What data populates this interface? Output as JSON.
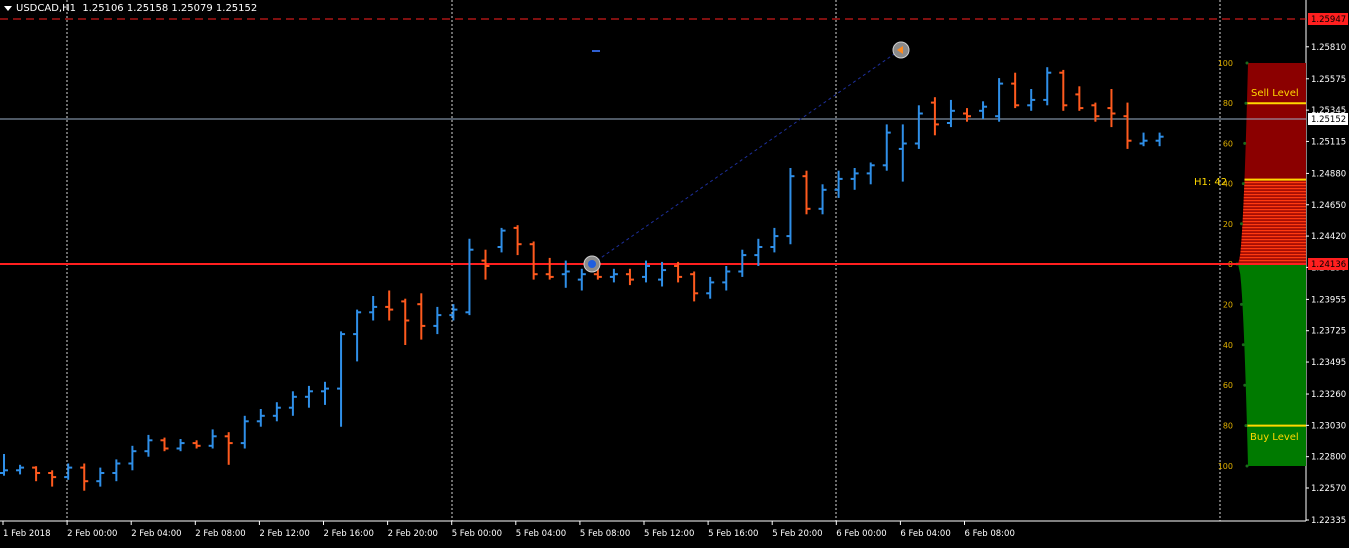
{
  "header": {
    "symbol": "USDCAD,H1",
    "ohlc": "1.25106 1.25158 1.25079 1.25152"
  },
  "colors": {
    "background": "#000000",
    "bull": "#2f8fe8",
    "bear": "#ff5a1e",
    "grid": "#ffffff",
    "axis_text": "#ffffff",
    "red_line": "#ff1f1f",
    "sell_zone": "#8b0000",
    "buy_zone": "#007a00",
    "level_line": "#ffd800",
    "scale_text": "#e0b000"
  },
  "chart_data": {
    "type": "ohlc",
    "price_axis": {
      "labels": [
        "1.25810",
        "1.25575",
        "1.25345",
        "1.25115",
        "1.24880",
        "1.24650",
        "1.24420",
        "1.24190",
        "1.23955",
        "1.23725",
        "1.23495",
        "1.23260",
        "1.23030",
        "1.22800",
        "1.22570",
        "1.22335"
      ],
      "range": [
        1.22335,
        1.2597
      ]
    },
    "time_axis": {
      "labels": [
        "1 Feb 2018",
        "2 Feb 00:00",
        "2 Feb 04:00",
        "2 Feb 08:00",
        "2 Feb 12:00",
        "2 Feb 16:00",
        "2 Feb 20:00",
        "5 Feb 00:00",
        "5 Feb 04:00",
        "5 Feb 08:00",
        "5 Feb 12:00",
        "5 Feb 16:00",
        "5 Feb 20:00",
        "6 Feb 00:00",
        "6 Feb 04:00",
        "6 Feb 08:00"
      ]
    },
    "current_price": "1.25152",
    "top_level_price": "1.25947",
    "red_level_price": "1.24136",
    "bars": [
      [
        1.2268,
        1.2282,
        1.2266,
        1.227
      ],
      [
        1.227,
        1.2274,
        1.2267,
        1.2272
      ],
      [
        1.2272,
        1.2273,
        1.2262,
        1.2268
      ],
      [
        1.2268,
        1.227,
        1.2258,
        1.2265
      ],
      [
        1.2265,
        1.2275,
        1.2263,
        1.2272
      ],
      [
        1.2272,
        1.2275,
        1.2255,
        1.2262
      ],
      [
        1.2262,
        1.2272,
        1.2258,
        1.2268
      ],
      [
        1.2268,
        1.2278,
        1.2262,
        1.2275
      ],
      [
        1.2275,
        1.2288,
        1.227,
        1.2284
      ],
      [
        1.2284,
        1.2296,
        1.228,
        1.2292
      ],
      [
        1.2292,
        1.2294,
        1.2284,
        1.2286
      ],
      [
        1.2286,
        1.2293,
        1.2284,
        1.229
      ],
      [
        1.229,
        1.2292,
        1.2286,
        1.2288
      ],
      [
        1.2288,
        1.23,
        1.2286,
        1.2295
      ],
      [
        1.2295,
        1.2298,
        1.2274,
        1.229
      ],
      [
        1.229,
        1.231,
        1.2286,
        1.2306
      ],
      [
        1.2306,
        1.2315,
        1.2302,
        1.231
      ],
      [
        1.231,
        1.232,
        1.2306,
        1.2316
      ],
      [
        1.2316,
        1.2328,
        1.231,
        1.2324
      ],
      [
        1.2324,
        1.2332,
        1.2316,
        1.2328
      ],
      [
        1.2328,
        1.2335,
        1.2318,
        1.233
      ],
      [
        1.233,
        1.2372,
        1.2302,
        1.237
      ],
      [
        1.237,
        1.2388,
        1.235,
        1.2386
      ],
      [
        1.2386,
        1.2398,
        1.238,
        1.239
      ],
      [
        1.239,
        1.2402,
        1.238,
        1.2388
      ],
      [
        1.2394,
        1.2396,
        1.2362,
        1.238
      ],
      [
        1.2392,
        1.24,
        1.2366,
        1.2376
      ],
      [
        1.2376,
        1.239,
        1.237,
        1.2384
      ],
      [
        1.2384,
        1.2392,
        1.238,
        1.2388
      ],
      [
        1.2386,
        1.244,
        1.2384,
        1.2432
      ],
      [
        1.2424,
        1.2432,
        1.241,
        1.242
      ],
      [
        1.2434,
        1.2448,
        1.243,
        1.2446
      ],
      [
        1.2448,
        1.245,
        1.2428,
        1.2436
      ],
      [
        1.2436,
        1.2438,
        1.241,
        1.2414
      ],
      [
        1.2414,
        1.2426,
        1.241,
        1.2412
      ],
      [
        1.2414,
        1.2424,
        1.2404,
        1.2416
      ],
      [
        1.241,
        1.2418,
        1.2402,
        1.2414
      ],
      [
        1.2414,
        1.2418,
        1.241,
        1.2412
      ],
      [
        1.2412,
        1.2418,
        1.2408,
        1.2414
      ],
      [
        1.2414,
        1.2418,
        1.2406,
        1.241
      ],
      [
        1.2412,
        1.2424,
        1.2408,
        1.242
      ],
      [
        1.241,
        1.2423,
        1.2405,
        1.2417
      ],
      [
        1.242,
        1.2423,
        1.2408,
        1.2412
      ],
      [
        1.2414,
        1.2416,
        1.2394,
        1.24
      ],
      [
        1.24,
        1.2412,
        1.2396,
        1.2408
      ],
      [
        1.2408,
        1.242,
        1.2402,
        1.2416
      ],
      [
        1.2416,
        1.2432,
        1.2412,
        1.2428
      ],
      [
        1.2428,
        1.244,
        1.242,
        1.2434
      ],
      [
        1.2434,
        1.2448,
        1.243,
        1.2442
      ],
      [
        1.2442,
        1.2492,
        1.2436,
        1.2486
      ],
      [
        1.2486,
        1.249,
        1.2458,
        1.2462
      ],
      [
        1.2462,
        1.248,
        1.2458,
        1.2476
      ],
      [
        1.2476,
        1.249,
        1.247,
        1.2484
      ],
      [
        1.2484,
        1.2492,
        1.2476,
        1.2488
      ],
      [
        1.2488,
        1.2496,
        1.248,
        1.2494
      ],
      [
        1.2494,
        1.2524,
        1.249,
        1.2518
      ],
      [
        1.2506,
        1.2524,
        1.2482,
        1.251
      ],
      [
        1.251,
        1.2538,
        1.2506,
        1.2532
      ],
      [
        1.254,
        1.2544,
        1.2516,
        1.2524
      ],
      [
        1.2525,
        1.2542,
        1.2522,
        1.2534
      ],
      [
        1.2532,
        1.2536,
        1.2526,
        1.253
      ],
      [
        1.2534,
        1.2541,
        1.2528,
        1.2537
      ],
      [
        1.253,
        1.2558,
        1.2526,
        1.2554
      ],
      [
        1.2554,
        1.2562,
        1.2536,
        1.2538
      ],
      [
        1.2538,
        1.255,
        1.2534,
        1.2542
      ],
      [
        1.2542,
        1.2566,
        1.2538,
        1.2562
      ],
      [
        1.2562,
        1.2564,
        1.2534,
        1.2538
      ],
      [
        1.2546,
        1.2552,
        1.2534,
        1.2536
      ],
      [
        1.2538,
        1.254,
        1.2526,
        1.253
      ],
      [
        1.2536,
        1.255,
        1.2522,
        1.2532
      ],
      [
        1.253,
        1.254,
        1.2506,
        1.2512
      ],
      [
        1.251,
        1.2518,
        1.2508,
        1.2512
      ],
      [
        1.2512,
        1.2518,
        1.2508,
        1.2515
      ]
    ]
  },
  "indicator": {
    "sell_label": "Sell Level",
    "buy_label": "Buy Level",
    "h1_label": "H1: 42",
    "upper_scale": [
      "100",
      "80",
      "60",
      "40",
      "20",
      "0"
    ],
    "lower_scale": [
      "20",
      "40",
      "60",
      "80",
      "100"
    ]
  }
}
